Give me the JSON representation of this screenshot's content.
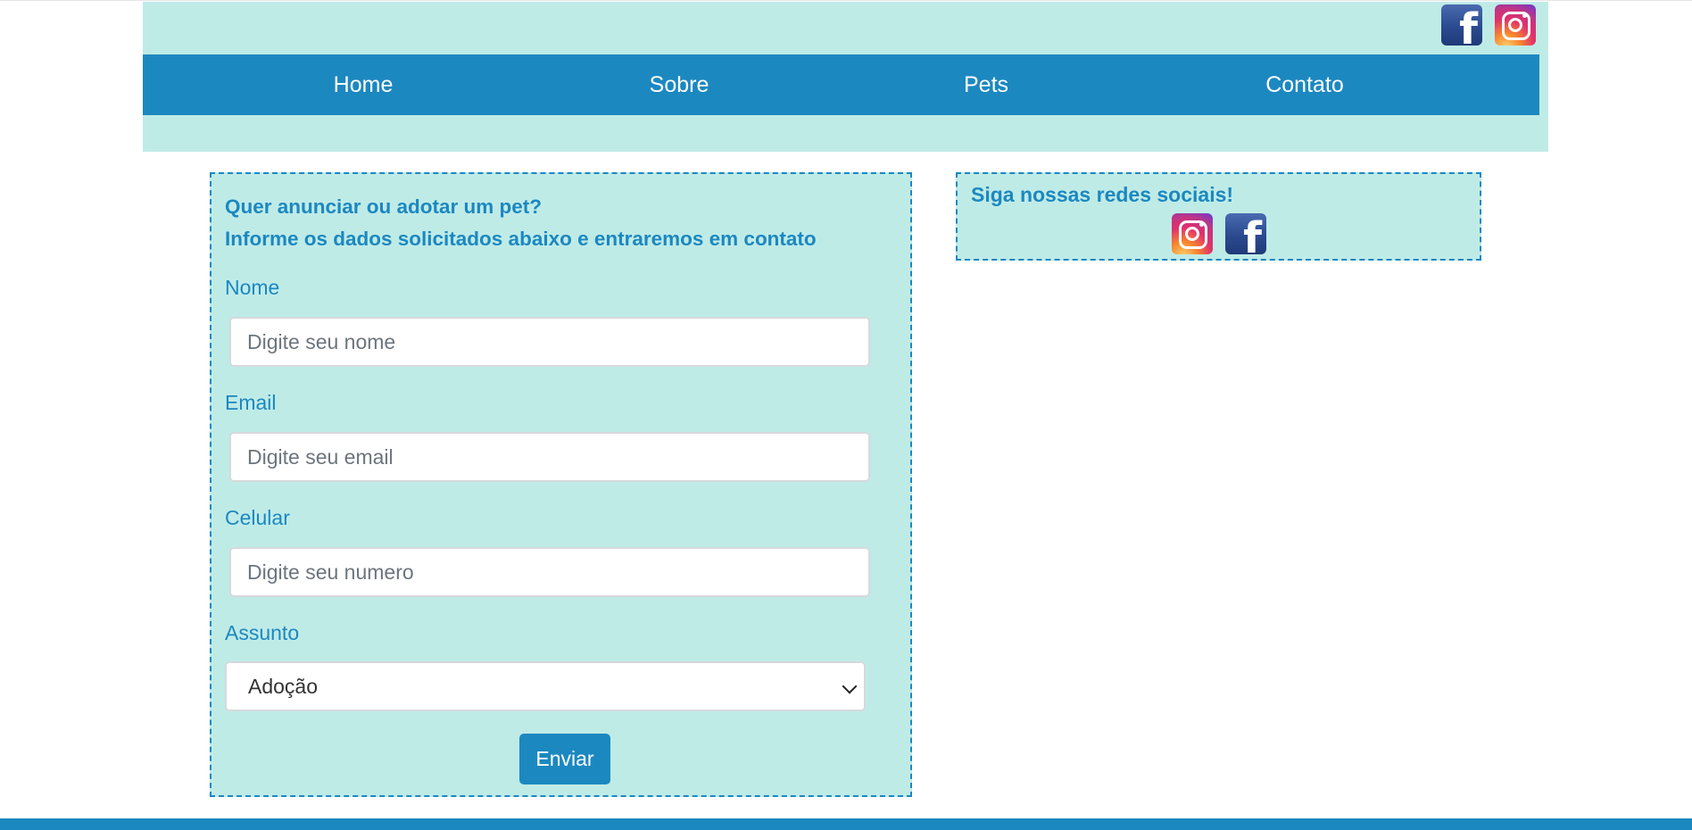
{
  "header": {
    "social_icons": [
      {
        "icon": "facebook-icon",
        "label": "f"
      },
      {
        "icon": "instagram-icon"
      }
    ]
  },
  "nav": {
    "items": [
      {
        "label": "Home"
      },
      {
        "label": "Sobre"
      },
      {
        "label": "Pets"
      },
      {
        "label": "Contato"
      }
    ]
  },
  "form": {
    "title_line1": "Quer anunciar ou adotar um pet?",
    "title_line2": "Informe os dados solicitados abaixo e entraremos em contato",
    "fields": [
      {
        "label": "Nome",
        "placeholder": "Digite seu nome",
        "value": ""
      },
      {
        "label": "Email",
        "placeholder": "Digite seu email",
        "value": ""
      },
      {
        "label": "Celular",
        "placeholder": "Digite seu numero",
        "value": ""
      }
    ],
    "subject": {
      "label": "Assunto",
      "selected": "Adoção"
    },
    "submit_label": "Enviar"
  },
  "social": {
    "title": "Siga nossas redes sociais!",
    "icons": [
      {
        "icon": "instagram-icon"
      },
      {
        "icon": "facebook-icon",
        "label": "f"
      }
    ]
  },
  "colors": {
    "primary": "#1c88c0",
    "panel_background": "#bfebe7",
    "page_background": "#ffffff"
  }
}
